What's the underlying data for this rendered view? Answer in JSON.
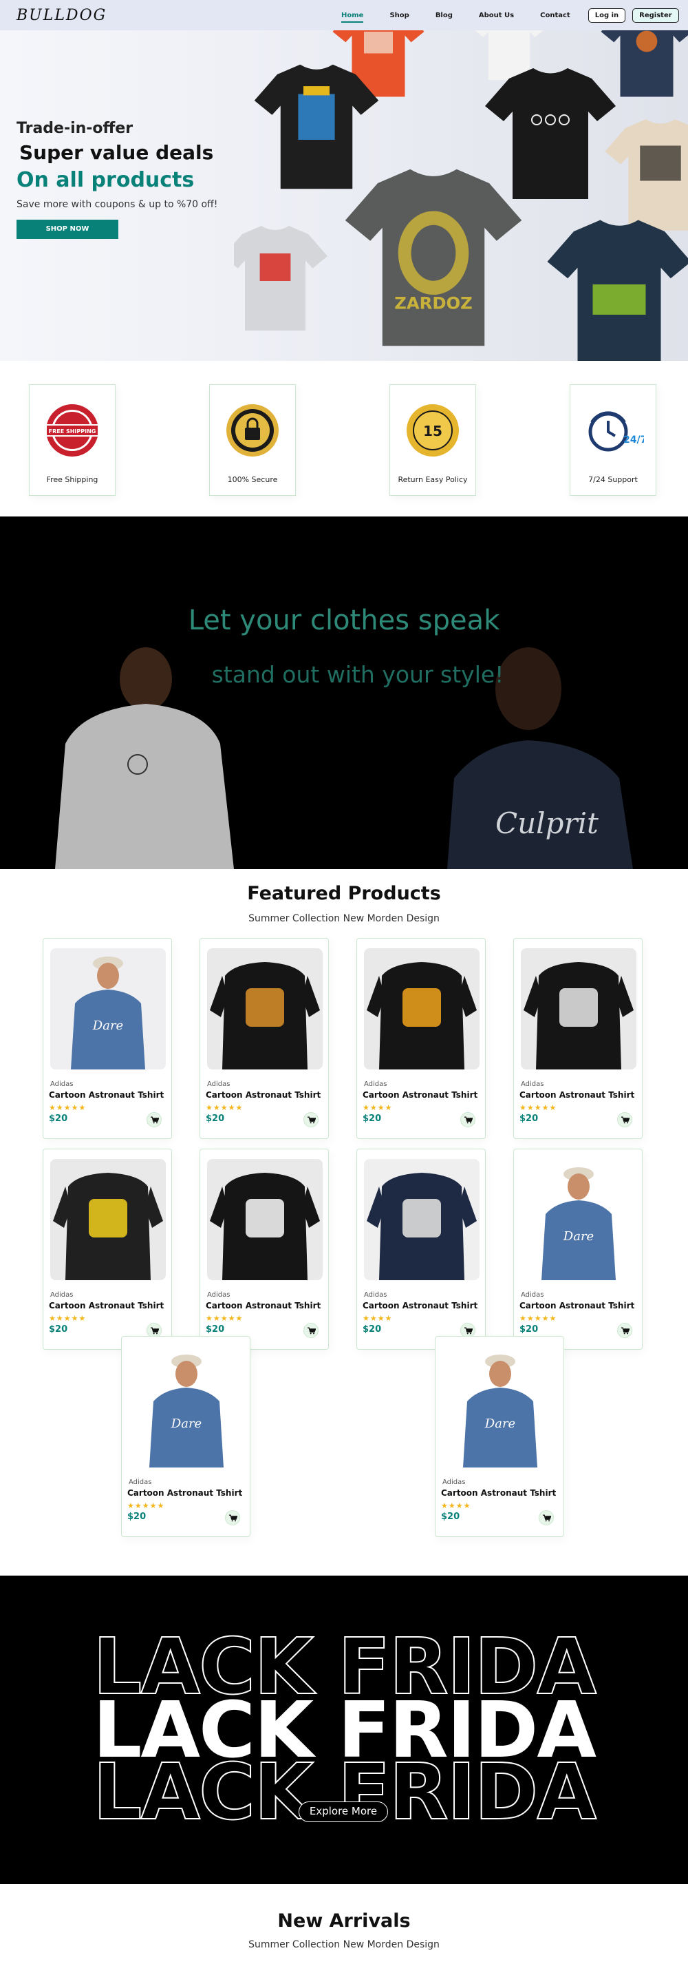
{
  "nav": {
    "logo": "BULLDOG",
    "links": [
      "Home",
      "Shop",
      "Blog",
      "About Us",
      "Contact"
    ],
    "login": "Log in",
    "register": "Register"
  },
  "hero": {
    "subtitle": "Trade-in-offer",
    "heading": "Super value deals",
    "highlight": "On all products",
    "text": "Save more with coupons & up to %70 off!",
    "button": "SHOP NOW"
  },
  "features": [
    {
      "label": "Free Shipping",
      "icon": "free-shipping-badge-icon"
    },
    {
      "label": "100% Secure",
      "icon": "secure-lock-badge-icon"
    },
    {
      "label": "Return Easy Policy",
      "icon": "easy-returns-badge-icon"
    },
    {
      "label": "7/24 Support",
      "icon": "support-clock-icon"
    }
  ],
  "banner": {
    "heading": "Let your clothes speak",
    "subheading": "stand out with your style!"
  },
  "featured": {
    "title": "Featured Products",
    "subtitle": "Summer Collection New Morden Design",
    "products": [
      {
        "brand": "Adidas",
        "name": "Cartoon Astronaut Tshirt",
        "stars": "★★★★★",
        "price": "$20"
      },
      {
        "brand": "Adidas",
        "name": "Cartoon Astronaut Tshirt",
        "stars": "★★★★★",
        "price": "$20"
      },
      {
        "brand": "Adidas",
        "name": "Cartoon Astronaut Tshirt",
        "stars": "★★★★",
        "price": "$20"
      },
      {
        "brand": "Adidas",
        "name": "Cartoon Astronaut Tshirt",
        "stars": "★★★★★",
        "price": "$20"
      },
      {
        "brand": "Adidas",
        "name": "Cartoon Astronaut Tshirt",
        "stars": "★★★★★",
        "price": "$20"
      },
      {
        "brand": "Adidas",
        "name": "Cartoon Astronaut Tshirt",
        "stars": "★★★★★",
        "price": "$20"
      },
      {
        "brand": "Adidas",
        "name": "Cartoon Astronaut Tshirt",
        "stars": "★★★★",
        "price": "$20"
      },
      {
        "brand": "Adidas",
        "name": "Cartoon Astronaut Tshirt",
        "stars": "★★★★★",
        "price": "$20"
      },
      {
        "brand": "Adidas",
        "name": "Cartoon Astronaut Tshirt",
        "stars": "★★★★★",
        "price": "$20"
      },
      {
        "brand": "Adidas",
        "name": "Cartoon Astronaut Tshirt",
        "stars": "★★★★",
        "price": "$20"
      }
    ]
  },
  "black_friday": {
    "text": "LACK FRIDA",
    "button": "Explore More"
  },
  "arrivals": {
    "title": "New Arrivals",
    "subtitle": "Summer Collection New Morden Design"
  },
  "colors": {
    "accent": "#088178",
    "nav_bg": "#e3e6f3",
    "star": "#f3b519"
  }
}
